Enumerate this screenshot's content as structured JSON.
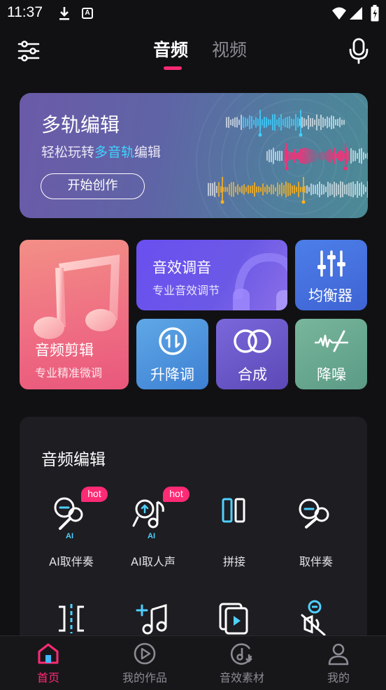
{
  "status_bar": {
    "time": "11:37",
    "a_icon": "A"
  },
  "header": {
    "tabs": [
      {
        "label": "音频",
        "active": true
      },
      {
        "label": "视频",
        "active": false
      }
    ],
    "accent_color": "#ff2a74"
  },
  "banner": {
    "title": "多轨编辑",
    "subtitle_pre": "轻松玩转",
    "subtitle_highlight": "多音轨",
    "subtitle_post": "编辑",
    "button": "开始创作"
  },
  "tiles": {
    "cut": {
      "title": "音频剪辑",
      "sub": "专业精准微调"
    },
    "fx": {
      "title": "音效调音",
      "sub": "专业音效调节"
    },
    "eq": {
      "title": "均衡器"
    },
    "pitch": {
      "title": "升降调"
    },
    "mix": {
      "title": "合成"
    },
    "nr": {
      "title": "降噪"
    }
  },
  "audio_edit": {
    "title": "音频编辑",
    "items": [
      {
        "label": "AI取伴奏",
        "badge": "hot",
        "ai": "AI",
        "icon": "mic-minus-icon"
      },
      {
        "label": "AI取人声",
        "badge": "hot",
        "ai": "AI",
        "icon": "voice-note-icon"
      },
      {
        "label": "拼接",
        "icon": "splice-icon"
      },
      {
        "label": "取伴奏",
        "icon": "mic-minus-icon"
      },
      {
        "label": "",
        "icon": "split-icon"
      },
      {
        "label": "",
        "icon": "add-music-icon"
      },
      {
        "label": "",
        "icon": "video-audio-icon"
      },
      {
        "label": "",
        "icon": "mute-mic-icon"
      }
    ]
  },
  "bottom_nav": [
    {
      "label": "首页",
      "icon": "home-icon",
      "active": true
    },
    {
      "label": "我的作品",
      "icon": "play-circle-icon",
      "active": false
    },
    {
      "label": "音效素材",
      "icon": "music-disc-icon",
      "active": false
    },
    {
      "label": "我的",
      "icon": "user-icon",
      "active": false
    }
  ]
}
